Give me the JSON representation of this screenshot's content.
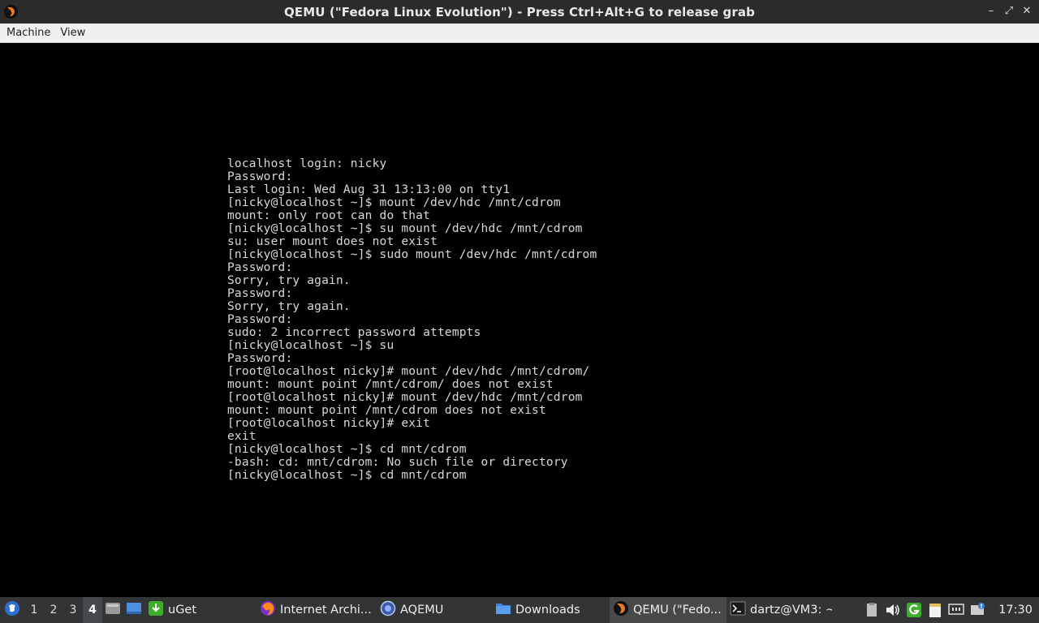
{
  "window": {
    "title": "QEMU (\"Fedora Linux Evolution\") - Press Ctrl+Alt+G to release grab",
    "app_icon": "qemu-icon",
    "controls": {
      "minimize": "–",
      "maximize": "⤢",
      "close": "✕"
    }
  },
  "menu": {
    "items": [
      "Machine",
      "View"
    ]
  },
  "console": {
    "lines": [
      "localhost login: nicky",
      "Password:",
      "Last login: Wed Aug 31 13:13:00 on tty1",
      "[nicky@localhost ~]$ mount /dev/hdc /mnt/cdrom",
      "mount: only root can do that",
      "[nicky@localhost ~]$ su mount /dev/hdc /mnt/cdrom",
      "su: user mount does not exist",
      "[nicky@localhost ~]$ sudo mount /dev/hdc /mnt/cdrom",
      "Password:",
      "Sorry, try again.",
      "Password:",
      "Sorry, try again.",
      "Password:",
      "sudo: 2 incorrect password attempts",
      "[nicky@localhost ~]$ su",
      "Password:",
      "[root@localhost nicky]# mount /dev/hdc /mnt/cdrom/",
      "mount: mount point /mnt/cdrom/ does not exist",
      "[root@localhost nicky]# mount /dev/hdc /mnt/cdrom",
      "mount: mount point /mnt/cdrom does not exist",
      "[root@localhost nicky]# exit",
      "exit",
      "[nicky@localhost ~]$ cd mnt/cdrom",
      "-bash: cd: mnt/cdrom: No such file or directory",
      "[nicky@localhost ~]$ cd mnt/cdrom"
    ]
  },
  "taskbar": {
    "workspaces": [
      "1",
      "2",
      "3",
      "4"
    ],
    "active_workspace": "4",
    "tasks": [
      {
        "label": "uGet",
        "icon": "uget-icon"
      },
      {
        "label": "Internet Archi...",
        "icon": "firefox-icon"
      },
      {
        "label": "AQEMU",
        "icon": "aqemu-icon"
      },
      {
        "label": "Downloads",
        "icon": "folder-icon"
      },
      {
        "label": "QEMU (\"Fedo...",
        "icon": "qemu-icon"
      },
      {
        "label": "dartz@VM3: ~",
        "icon": "terminal-icon"
      }
    ],
    "clock": "17:30"
  },
  "colors": {
    "titlebar_bg": "#2b2b2b",
    "menubar_bg": "#f0f0f0",
    "console_bg": "#000000",
    "console_fg": "#d8d8d8",
    "taskbar_bg": "#323436",
    "accent_green": "#3fae2a",
    "accent_blue": "#3b82d8"
  }
}
